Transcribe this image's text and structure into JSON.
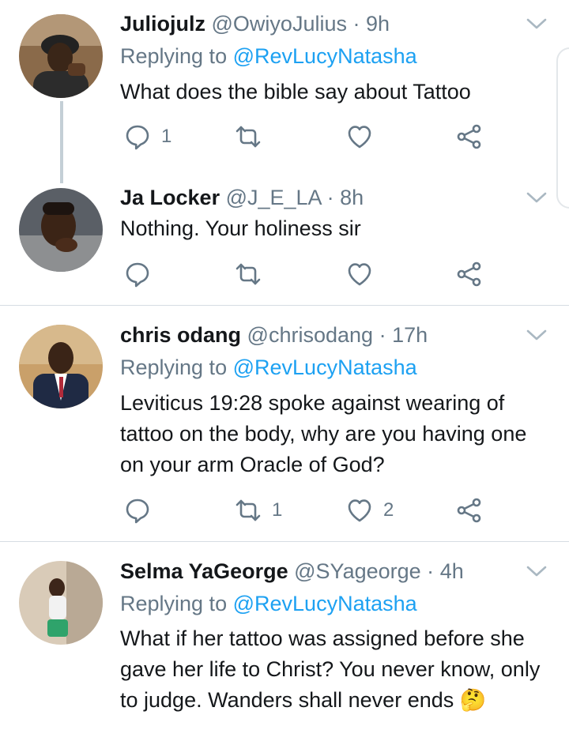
{
  "accent": "#1da1f2",
  "tweets": [
    {
      "name": "Juliojulz",
      "handle": "@OwiyoJulius",
      "dot": "·",
      "time": "9h",
      "replying_prefix": "Replying to",
      "replying_mention": "@RevLucyNatasha",
      "text": "What does the bible say about Tattoo",
      "reply_count": "1",
      "retweet_count": "",
      "like_count": ""
    },
    {
      "name": "Ja Locker",
      "handle": "@J_E_LA",
      "dot": "·",
      "time": "8h",
      "text": "Nothing. Your holiness sir",
      "reply_count": "",
      "retweet_count": "",
      "like_count": ""
    },
    {
      "name": "chris odang",
      "handle": "@chrisodang",
      "dot": "·",
      "time": "17h",
      "replying_prefix": "Replying to",
      "replying_mention": "@RevLucyNatasha",
      "text": "Leviticus 19:28 spoke against wearing of tattoo on the body, why are you having one on your arm Oracle of God?",
      "reply_count": "",
      "retweet_count": "1",
      "like_count": "2"
    },
    {
      "name": "Selma YaGeorge",
      "handle": "@SYageorge",
      "dot": "·",
      "time": "4h",
      "replying_prefix": "Replying to",
      "replying_mention": "@RevLucyNatasha",
      "text": "What if her tattoo was assigned before she gave her life to Christ? You never know, only to judge. Wanders shall never ends",
      "emoji": "🤔"
    }
  ]
}
